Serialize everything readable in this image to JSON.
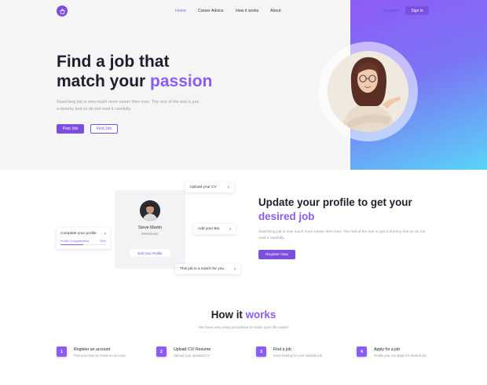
{
  "nav": {
    "logo_icon": "basket-icon",
    "links": [
      "Home",
      "Career Advice",
      "How it works",
      "About"
    ],
    "active": "Home",
    "register": "Register",
    "sign_in": "Sign in"
  },
  "hero": {
    "title_line1": "Find a job that",
    "title_line2_prefix": "match your ",
    "title_accent": "passion",
    "description": "Searching job is now much more easier then ever. The rest of the text is just a dummy text so do not read it carefully.",
    "post_job": "Post Job",
    "find_job": "Find Job"
  },
  "profile": {
    "name": "Steve Martin",
    "role": "Electrician",
    "edit": "Edit Your Profile",
    "upload_cv": "Upload your CV",
    "add_bio": "Add your Bio",
    "match": "This job is a match for you",
    "complete_title": "Complete your profile",
    "profile_completeness_label": "Profile Completeness",
    "profile_completeness_value": "50%",
    "profile_completeness": 0.5
  },
  "update": {
    "title_prefix": "Update your profile to get your ",
    "title_accent": "desired job",
    "description": "Searching job is now much more easier then ever. The rest of the text is just a dummy text so do not read it carefully.",
    "register_now": "Register Now"
  },
  "how": {
    "title_prefix": "How it ",
    "title_accent": "works",
    "description": "We have very easy procedure to make your life easier",
    "steps": [
      {
        "num": "1",
        "title": "Register an account",
        "desc": "First you need to create an account"
      },
      {
        "num": "2",
        "title": "Upload CV/ Resume",
        "desc": "Upload your updated CV"
      },
      {
        "num": "3",
        "title": "Find a job",
        "desc": "Keep looking for your suitable job"
      },
      {
        "num": "4",
        "title": "Apply for a job",
        "desc": "Finally you can apply for desired job"
      }
    ]
  },
  "colors": {
    "accent": "#8b5cf6",
    "button": "#7c4fe0",
    "gradient_start": "#8f5cf7",
    "gradient_end": "#5ad4f7"
  }
}
